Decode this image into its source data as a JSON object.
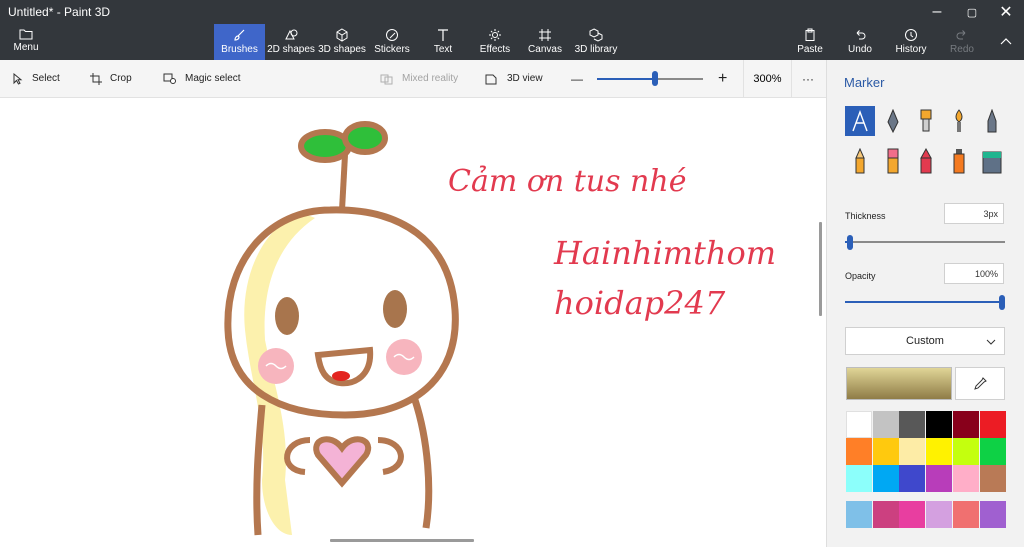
{
  "window": {
    "title": "Untitled* - Paint 3D",
    "controls": {
      "minimize": "–",
      "maximize": "▢",
      "close": "✕"
    }
  },
  "toolbar": {
    "menu_label": "Menu",
    "tools": [
      {
        "label": "Brushes",
        "icon": "brush-icon",
        "active": true
      },
      {
        "label": "2D shapes",
        "icon": "2d-shapes-icon"
      },
      {
        "label": "3D shapes",
        "icon": "3d-shapes-icon"
      },
      {
        "label": "Stickers",
        "icon": "stickers-icon"
      },
      {
        "label": "Text",
        "icon": "text-icon"
      },
      {
        "label": "Effects",
        "icon": "effects-icon"
      },
      {
        "label": "Canvas",
        "icon": "canvas-icon"
      },
      {
        "label": "3D library",
        "icon": "3d-library-icon"
      }
    ],
    "right": [
      {
        "label": "Paste",
        "icon": "paste-icon"
      },
      {
        "label": "Undo",
        "icon": "undo-icon"
      },
      {
        "label": "History",
        "icon": "history-icon"
      },
      {
        "label": "Redo",
        "icon": "redo-icon",
        "disabled": true
      }
    ]
  },
  "subbar": {
    "select": "Select",
    "crop": "Crop",
    "magic_select": "Magic select",
    "mixed_reality": "Mixed reality",
    "view_3d": "3D view",
    "zoom_minus": "—",
    "zoom_plus": "+",
    "zoom_value": "300%",
    "zoom_fraction": 0.55,
    "more": "···"
  },
  "canvas": {
    "text_line1": "Cảm ơn tus nhé",
    "text_line2": "Hainhimthom",
    "text_line3": "hoidap247",
    "text_color": "#e23a4f"
  },
  "panel": {
    "title": "Marker",
    "brushes": [
      "marker",
      "calligraphy-pen",
      "oil-brush",
      "watercolor",
      "pixel-pen",
      "pencil",
      "eraser",
      "crayon",
      "spray-can",
      "fill"
    ],
    "selected_brush": "marker",
    "thickness_label": "Thickness",
    "thickness_value": "3px",
    "thickness_fraction": 0.03,
    "opacity_label": "Opacity",
    "opacity_value": "100%",
    "opacity_fraction": 1.0,
    "custom_label": "Custom",
    "current_color": "#e0d597",
    "palette": [
      "#ffffff",
      "#c3c3c3",
      "#585858",
      "#000000",
      "#88001b",
      "#ec1c24",
      "#ff7f27",
      "#ffc90e",
      "#fdeca6",
      "#fff200",
      "#c4ff0e",
      "#0ed145",
      "#8cfffb",
      "#00a8f3",
      "#3f48cc",
      "#b83dba",
      "#ffaec8",
      "#b97a56"
    ],
    "custom_colors": [
      "#7fc0e8",
      "#cc4080",
      "#e83ea0",
      "#d4a0e0",
      "#f07070",
      "#a060d0"
    ]
  }
}
